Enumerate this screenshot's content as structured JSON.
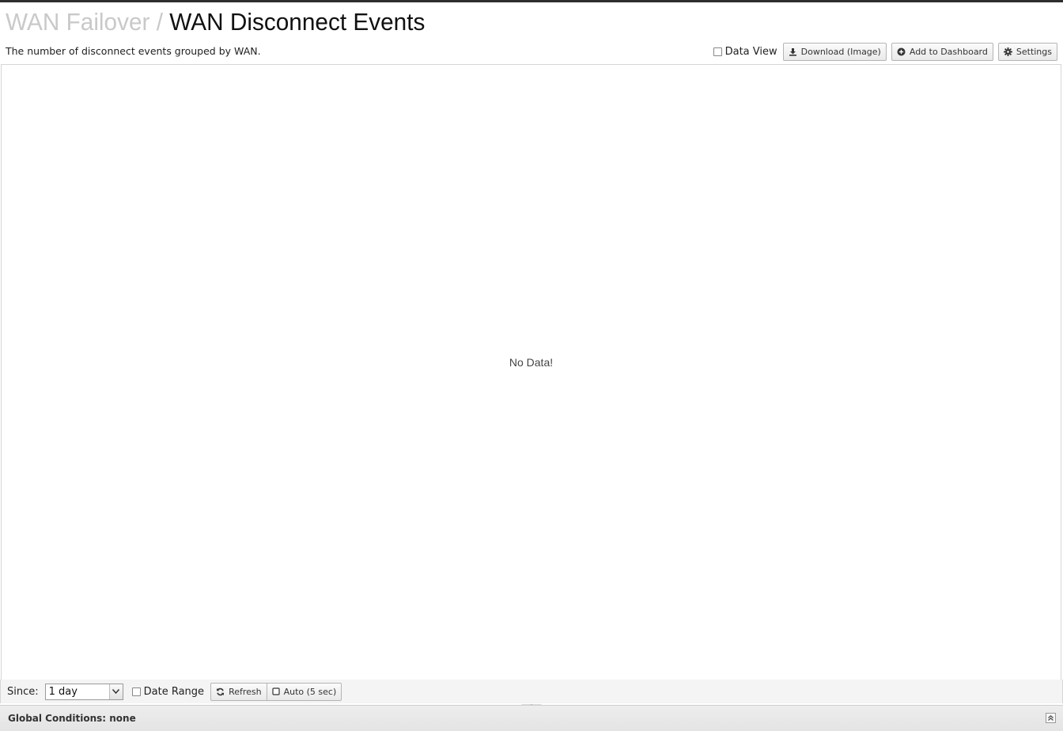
{
  "header": {
    "breadcrumb_parent": "WAN Failover",
    "breadcrumb_separator": "/",
    "title": "WAN Disconnect Events",
    "description": "The number of disconnect events grouped by WAN."
  },
  "toolbar": {
    "data_view_label": "Data View",
    "data_view_checked": false,
    "download_label": "Download (Image)",
    "download_icon": "download-icon",
    "add_dashboard_label": "Add to Dashboard",
    "add_dashboard_icon": "plus-circle-icon",
    "settings_label": "Settings",
    "settings_icon": "gear-icon"
  },
  "chart": {
    "empty_message": "No Data!"
  },
  "controls": {
    "since_label": "Since:",
    "since_value": "1 day",
    "date_range_label": "Date Range",
    "date_range_checked": false,
    "refresh_label": "Refresh",
    "refresh_icon": "refresh-icon",
    "auto_label": "Auto (5 sec)",
    "auto_icon": "checkbox-empty-icon"
  },
  "footer": {
    "global_conditions": "Global Conditions: none"
  }
}
